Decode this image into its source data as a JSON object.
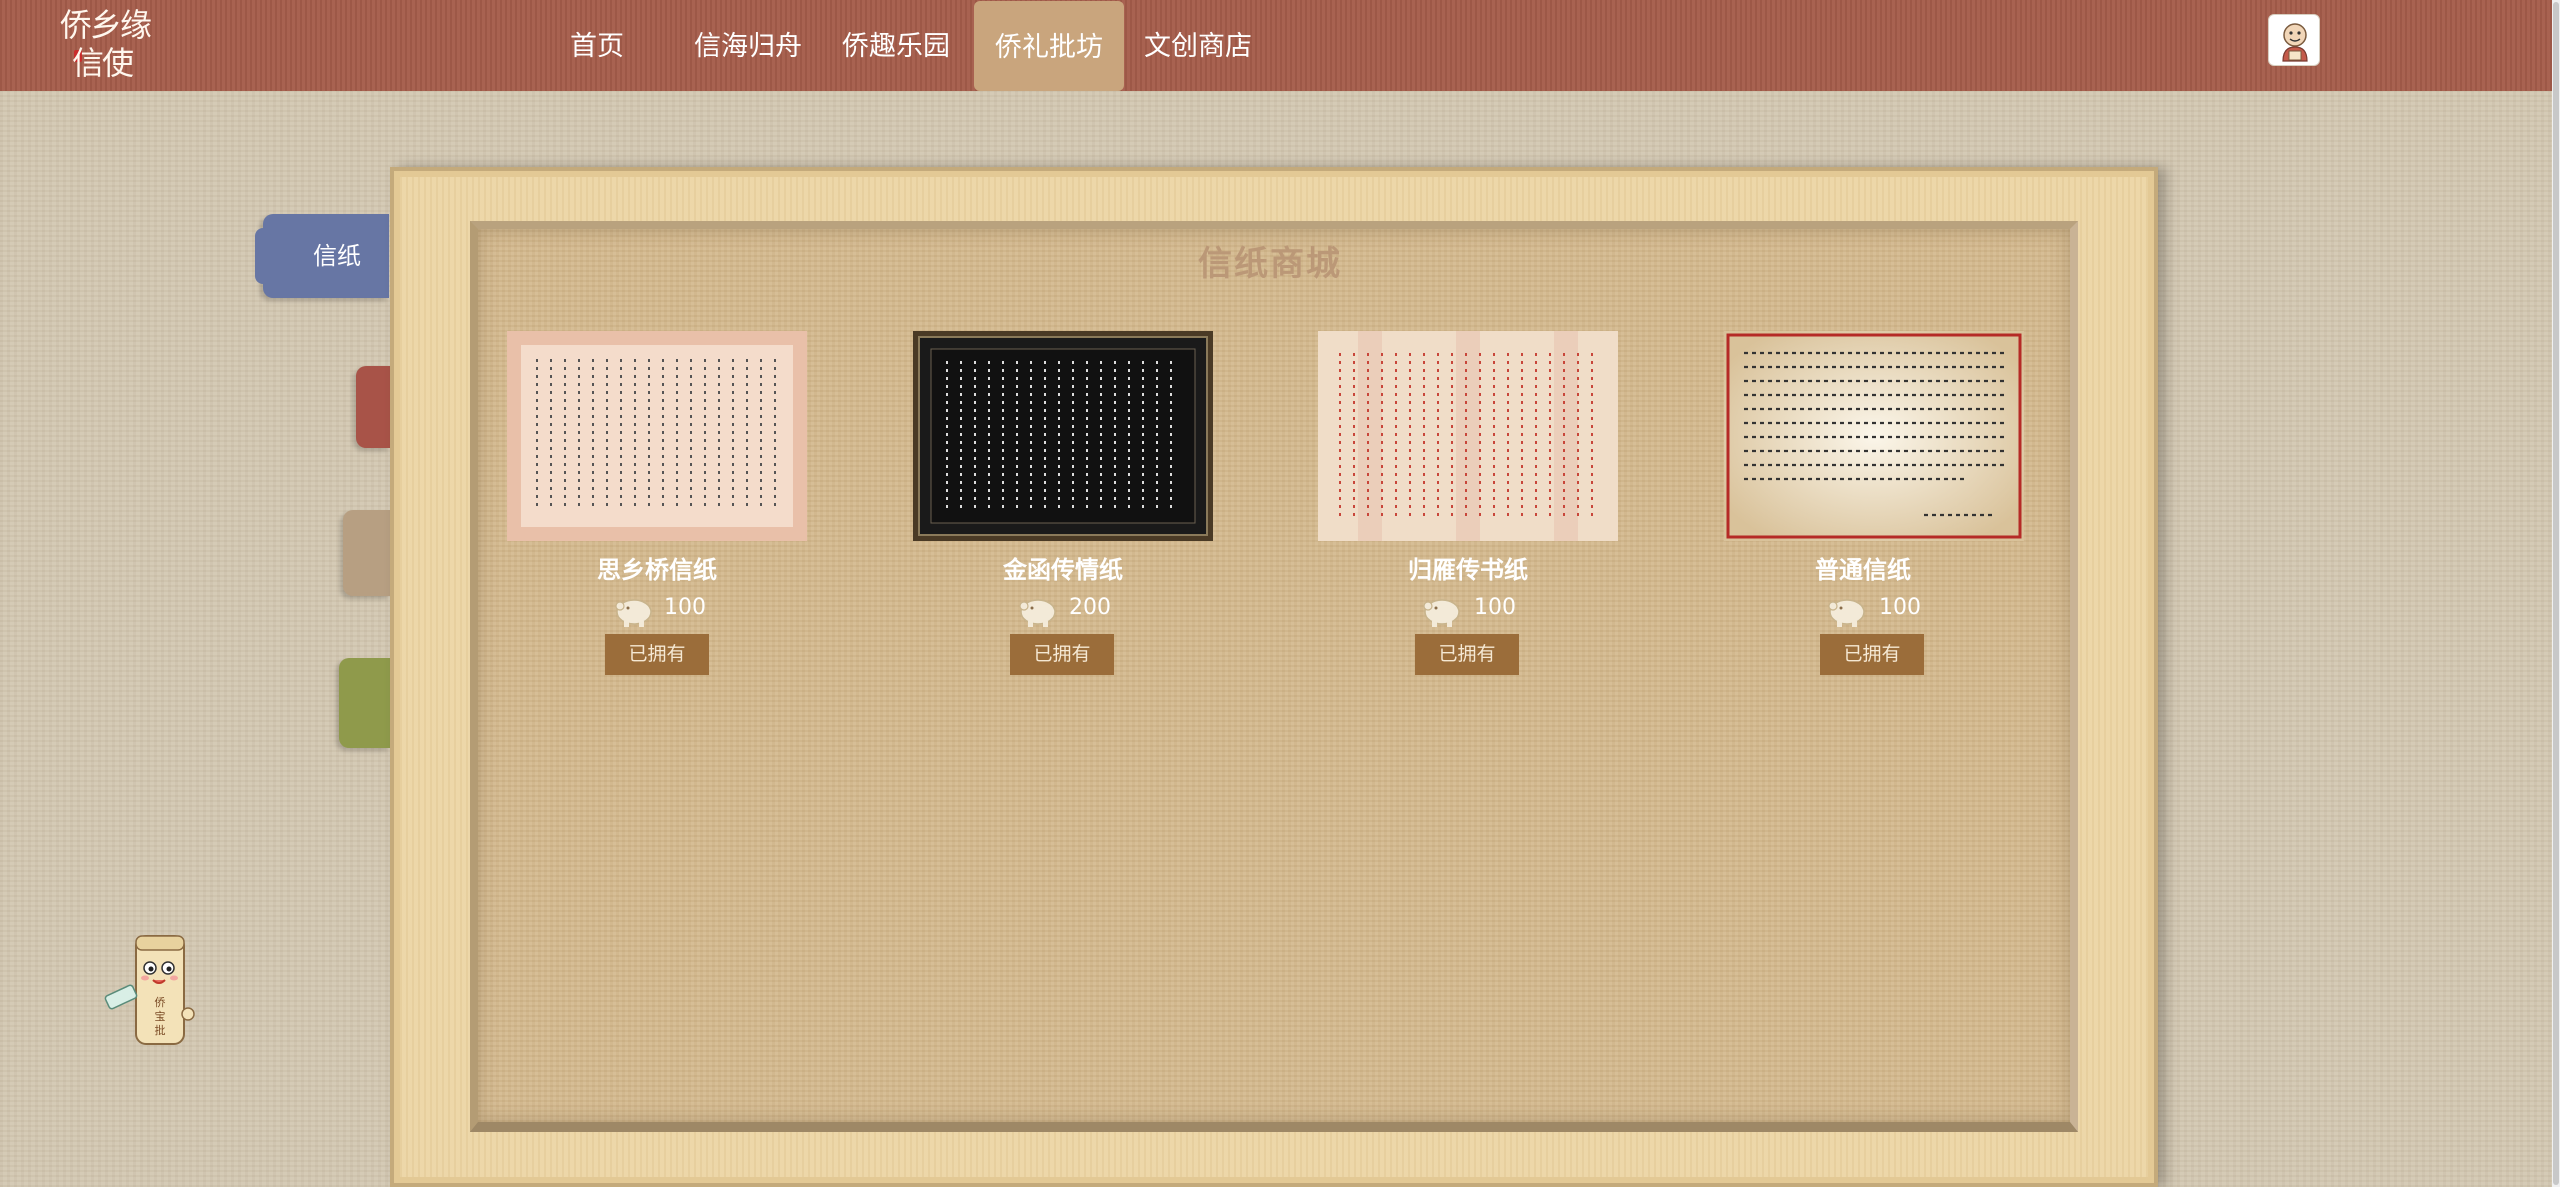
{
  "logo": {
    "line1": "侨乡缘",
    "line2": "信使"
  },
  "nav": [
    {
      "label": "首页",
      "active": false
    },
    {
      "label": "信海归舟",
      "active": false
    },
    {
      "label": "侨趣乐园",
      "active": false
    },
    {
      "label": "侨礼批坊",
      "active": true
    },
    {
      "label": "文创商店",
      "active": false
    }
  ],
  "side_tabs": [
    {
      "label": "信纸",
      "color": "#6776a4"
    },
    {
      "label": "",
      "color": "#a85348"
    },
    {
      "label": "",
      "color": "#b79f82"
    },
    {
      "label": "",
      "color": "#8f9a4b"
    }
  ],
  "mascot_label": "侨宝批",
  "shop": {
    "title": "信纸商城",
    "products": [
      {
        "name": "思乡桥信纸",
        "price": "100",
        "button": "已拥有",
        "style": "pink",
        "icon": "pig-coin-icon"
      },
      {
        "name": "金函传情纸",
        "price": "200",
        "button": "已拥有",
        "style": "black",
        "icon": "pig-coin-icon"
      },
      {
        "name": "归雁传书纸",
        "price": "100",
        "button": "已拥有",
        "style": "red-lines",
        "icon": "pig-coin-icon"
      },
      {
        "name": "普通信纸",
        "price": "100",
        "button": "已拥有",
        "style": "plain",
        "icon": "pig-coin-icon"
      }
    ]
  },
  "colors": {
    "topbar": "#a55d4b",
    "nav_active": "#c9a57d",
    "button": "#9b6d3a",
    "title": "#bb9877"
  }
}
